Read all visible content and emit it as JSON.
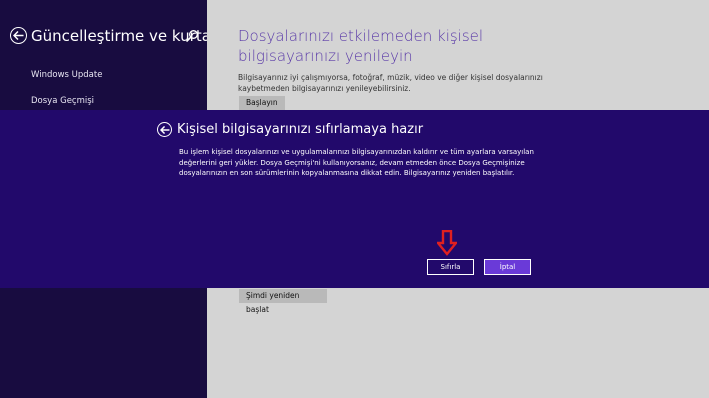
{
  "sidebar": {
    "title": "Güncelleştirme ve kurtar...",
    "back_icon": "back-arrow-icon",
    "search_icon": "search-icon",
    "items": [
      {
        "label": "Windows Update"
      },
      {
        "label": "Dosya Geçmişi"
      }
    ]
  },
  "main": {
    "heading": "Dosyalarınızı etkilemeden kişisel bilgisayarınızı yenileyin",
    "description": "Bilgisayarınız iyi çalışmıyorsa, fotoğraf, müzik, video ve diğer kişisel dosyalarınızı kaybetmeden bilgisayarınızı yenileyebilirsiniz.",
    "start_button": "Başlayın",
    "restart_button": "Şimdi yeniden başlat"
  },
  "dialog": {
    "title": "Kişisel bilgisayarınızı sıfırlamaya hazır",
    "body": "Bu işlem kişisel dosyalarınızı ve uygulamalarınızı bilgisayarınızdan kaldırır ve tüm ayarlara varsayılan değerlerini geri yükler. Dosya Geçmişi'ni kullanıyorsanız, devam etmeden önce Dosya Geçmişinize dosyalarınızın en son sürümlerinin kopyalanmasına dikkat edin. Bilgisayarınız yeniden başlatılır.",
    "reset_button": "Sıfırla",
    "cancel_button": "İptal"
  },
  "colors": {
    "dialog_bg": "#22096b",
    "sidebar_bg": "#180c40",
    "accent": "#6a3ad8",
    "heading": "#5a3aa8",
    "annotation_arrow": "#e02020"
  }
}
